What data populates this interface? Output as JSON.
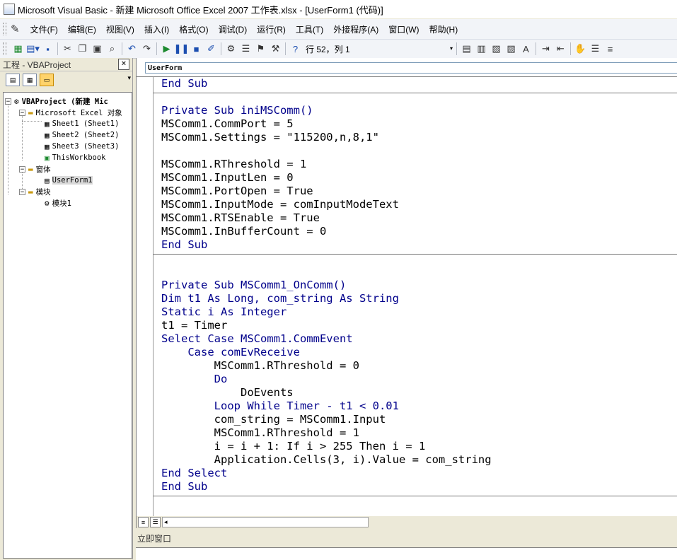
{
  "window": {
    "title": "Microsoft Visual Basic - 新建 Microsoft Office Excel 2007 工作表.xlsx - [UserForm1 (代码)]"
  },
  "menubar": {
    "items": [
      "文件(F)",
      "编辑(E)",
      "视图(V)",
      "插入(I)",
      "格式(O)",
      "调试(D)",
      "运行(R)",
      "工具(T)",
      "外接程序(A)",
      "窗口(W)",
      "帮助(H)"
    ]
  },
  "toolbar": {
    "position_text": "行 52，列 1"
  },
  "project_pane": {
    "title": "工程 - VBAProject",
    "close_label": "×",
    "tree": {
      "project": "VBAProject (新建 Mic",
      "excel_objects_folder": "Microsoft Excel 对象",
      "sheet1": "Sheet1 (Sheet1)",
      "sheet2": "Sheet2 (Sheet2)",
      "sheet3": "Sheet3 (Sheet3)",
      "thisworkbook": "ThisWorkbook",
      "forms_folder": "窗体",
      "userform1": "UserForm1",
      "modules_folder": "模块",
      "module1": "模块1"
    }
  },
  "code_window": {
    "object_combo": "UserForm",
    "lines": {
      "l1": "End Sub",
      "l2": "Private Sub iniMSComm()",
      "l3": "MSComm1.CommPort = 5",
      "l4": "MSComm1.Settings = \"115200,n,8,1\"",
      "l5": "MSComm1.RThreshold = 1",
      "l6": "MSComm1.InputLen = 0",
      "l7": "MSComm1.PortOpen = True",
      "l8": "MSComm1.InputMode = comInputModeText",
      "l9": "MSComm1.RTSEnable = True",
      "l10": "MSComm1.InBufferCount = 0",
      "l11": "End Sub",
      "l12": "Private Sub MSComm1_OnComm()",
      "l13": "Dim t1 As Long, com_string As String",
      "l14": "Static i As Integer",
      "l15": "t1 = Timer",
      "l16": "Select Case MSComm1.CommEvent",
      "l17": "    Case comEvReceive",
      "l18": "        MSComm1.RThreshold = 0",
      "l19": "        Do",
      "l20": "            DoEvents",
      "l21": "        Loop While Timer - t1 < 0.01",
      "l22": "        com_string = MSComm1.Input",
      "l23": "        MSComm1.RThreshold = 1",
      "l24": "        i = i + 1: If i > 255 Then i = 1",
      "l25": "        Application.Cells(3, i).Value = com_string",
      "l26": "End Select",
      "l27": "End Sub"
    }
  },
  "immediate": {
    "title": "立即窗口"
  },
  "colors": {
    "keyword": "#00008b",
    "chrome": "#ece9d8",
    "toolbar": "#f2f4f8"
  }
}
